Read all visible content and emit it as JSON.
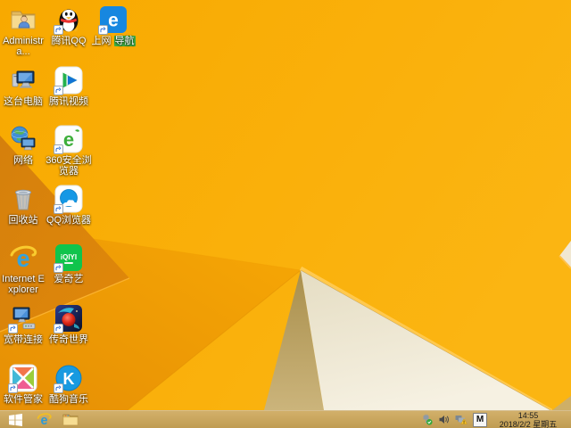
{
  "desktop": {
    "icons": [
      {
        "label": "Administra...",
        "icon": "user-folder-icon"
      },
      {
        "label": "腾讯QQ",
        "icon": "qq-penguin-icon"
      },
      {
        "label": "上网",
        "label_badge": "导航",
        "icon": "web-navigation-e-icon"
      },
      {
        "label": "这台电脑",
        "icon": "this-pc-icon"
      },
      {
        "label": "腾讯视频",
        "icon": "tencent-video-play-icon"
      },
      {
        "label": "网络",
        "icon": "network-globe-icon"
      },
      {
        "label": "360安全浏览器",
        "icon": "360-browser-e-icon"
      },
      {
        "label": "回收站",
        "icon": "recycle-bin-icon"
      },
      {
        "label": "QQ浏览器",
        "icon": "qq-browser-cloud-icon"
      },
      {
        "label": "Internet Explorer",
        "icon": "internet-explorer-icon"
      },
      {
        "label": "爱奇艺",
        "icon": "iqiyi-icon"
      },
      {
        "label": "宽带连接",
        "icon": "broadband-connection-icon"
      },
      {
        "label": "传奇世界",
        "icon": "legend-world-game-icon"
      },
      {
        "label": "软件管家",
        "icon": "software-manager-icon"
      },
      {
        "label": "酷狗音乐",
        "icon": "kugou-music-icon"
      }
    ]
  },
  "taskbar": {
    "items": [
      "windows-start",
      "internet-explorer",
      "file-explorer"
    ],
    "tray_icons": [
      "usb-safely-remove",
      "volume",
      "network-warning"
    ],
    "ime_indicator": "M",
    "clock": {
      "time": "14:55",
      "date": "2018/2/2 星期五"
    }
  },
  "colors": {
    "wallpaper_base": "#f9ac03",
    "wallpaper_bright": "#fbb512",
    "wallpaper_dark_facet": "#d8830b",
    "wallpaper_white_facet": "#f5f0e1",
    "wallpaper_shadow_facet": "#b49b5f",
    "fold_highlight": "#ffc94f",
    "taskbar": "#c7a45c",
    "iqiyi_green": "#10c44c",
    "kugou_blue": "#189ae0",
    "badge_green": "#3fae3f"
  }
}
